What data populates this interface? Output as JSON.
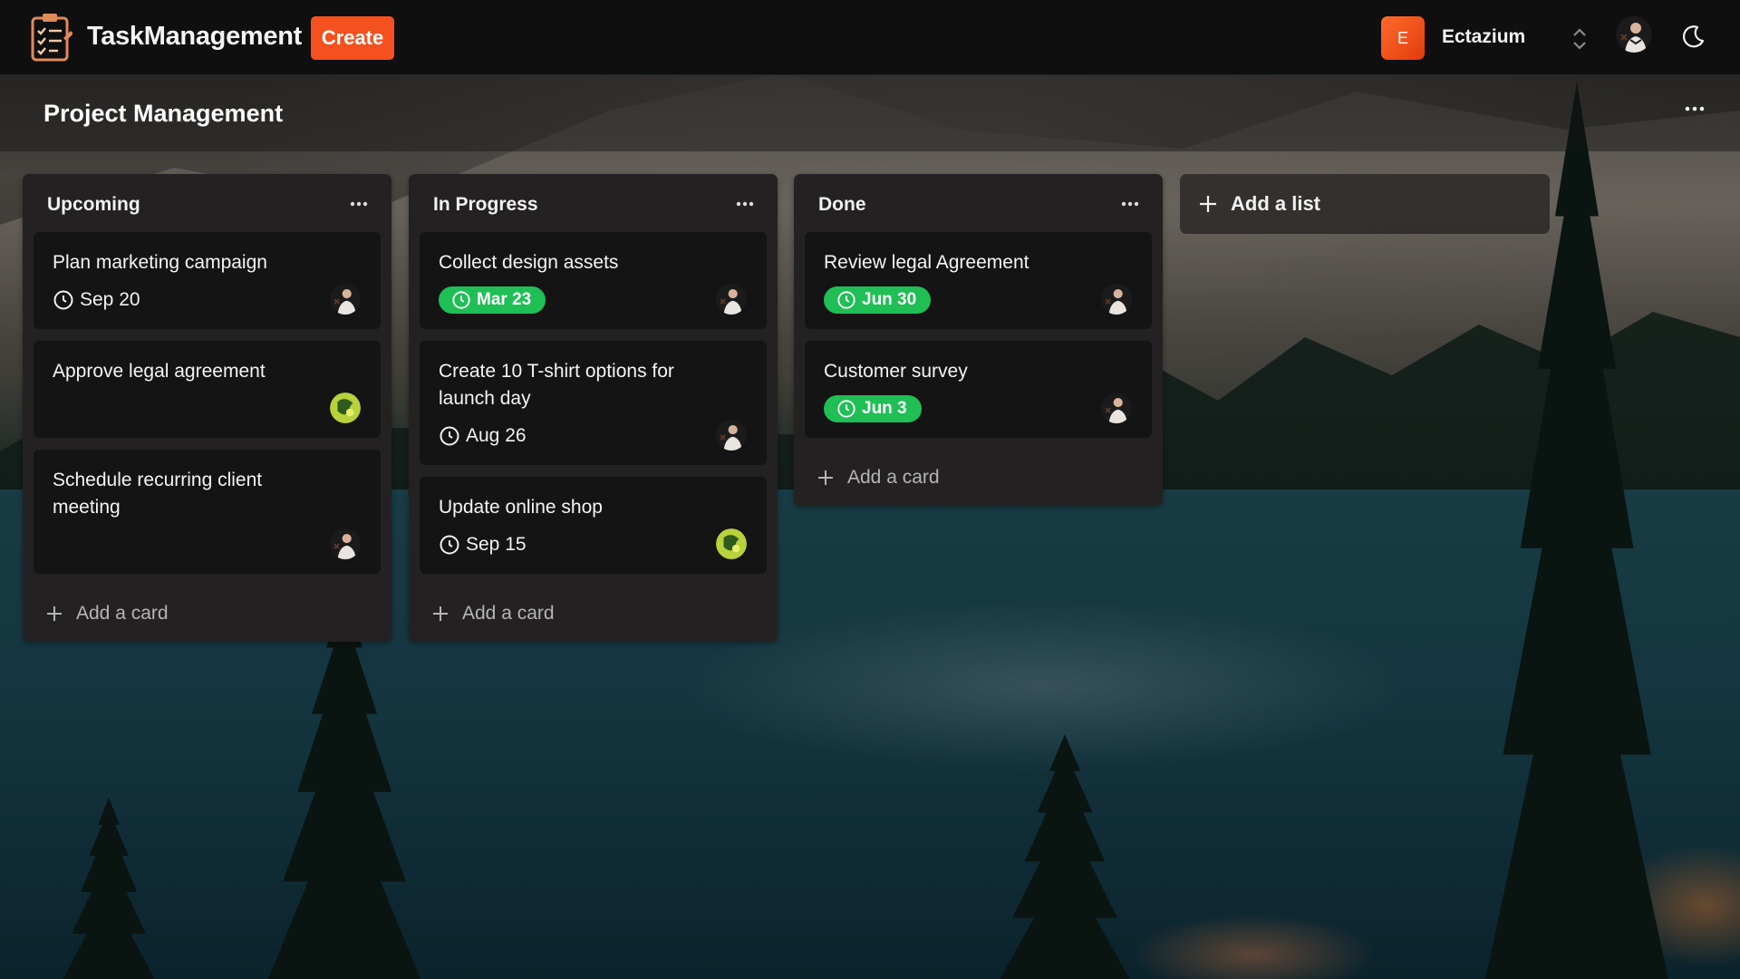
{
  "app": {
    "brand": "TaskManagement",
    "create_label": "Create",
    "workspace_initial": "E",
    "workspace_name": "Ectazium",
    "accent_color": "#f4511e",
    "done_color": "#1fbf55"
  },
  "icons": {
    "logo": "clipboard-checklist-icon",
    "workspace_switch": "chevron-up-down-icon",
    "theme": "moon-icon",
    "menu": "ellipsis-icon",
    "clock": "clock-icon",
    "add": "plus-icon"
  },
  "board": {
    "title": "Project Management",
    "add_list_label": "Add a list",
    "add_card_label": "Add a card",
    "lists": [
      {
        "title": "Upcoming",
        "cards": [
          {
            "title": "Plan marketing campaign",
            "due": "Sep 20",
            "due_done": false,
            "avatar": "man-avatar"
          },
          {
            "title": "Approve legal agreement",
            "due": "",
            "due_done": false,
            "avatar": "green-avatar"
          },
          {
            "title": "Schedule recurring client meeting",
            "due": "",
            "due_done": false,
            "avatar": "man-avatar"
          }
        ]
      },
      {
        "title": "In Progress",
        "cards": [
          {
            "title": "Collect design assets",
            "due": "Mar 23",
            "due_done": true,
            "avatar": "man-avatar"
          },
          {
            "title": "Create 10 T-shirt options for launch day",
            "due": "Aug 26",
            "due_done": false,
            "avatar": "man-avatar"
          },
          {
            "title": "Update online shop",
            "due": "Sep 15",
            "due_done": false,
            "avatar": "green-avatar"
          }
        ]
      },
      {
        "title": "Done",
        "cards": [
          {
            "title": "Review legal Agreement",
            "due": "Jun 30",
            "due_done": true,
            "avatar": "man-avatar"
          },
          {
            "title": "Customer survey",
            "due": "Jun 3",
            "due_done": true,
            "avatar": "man-avatar"
          }
        ]
      }
    ]
  }
}
